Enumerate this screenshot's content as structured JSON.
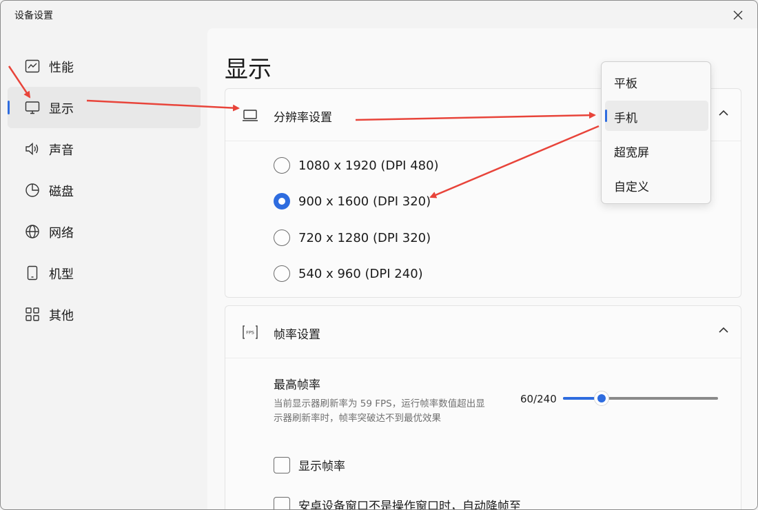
{
  "window": {
    "title": "设备设置"
  },
  "sidebar": {
    "items": [
      {
        "label": "性能",
        "icon": "performance-chart-icon",
        "active": false
      },
      {
        "label": "显示",
        "icon": "monitor-icon",
        "active": true
      },
      {
        "label": "声音",
        "icon": "speaker-icon",
        "active": false
      },
      {
        "label": "磁盘",
        "icon": "pie-chart-icon",
        "active": false
      },
      {
        "label": "网络",
        "icon": "globe-icon",
        "active": false
      },
      {
        "label": "机型",
        "icon": "phone-icon",
        "active": false
      },
      {
        "label": "其他",
        "icon": "grid-icon",
        "active": false
      }
    ]
  },
  "main": {
    "title": "显示",
    "resolution": {
      "title": "分辨率设置",
      "options": [
        {
          "label": "1080 x 1920 (DPI 480)",
          "checked": false
        },
        {
          "label": "900 x 1600 (DPI 320)",
          "checked": true
        },
        {
          "label": "720 x 1280 (DPI 320)",
          "checked": false
        },
        {
          "label": "540 x 960 (DPI 240)",
          "checked": false
        }
      ]
    },
    "framerate": {
      "title": "帧率设置",
      "icon_text": "FPS",
      "max_label": "最高帧率",
      "description": "当前显示器刷新率为 59 FPS，运行帧率数值超出显示器刷新率时，帧率突破达不到最优效果",
      "value_text": "60/240",
      "value": 60,
      "max": 240,
      "checkboxes": [
        {
          "label": "显示帧率",
          "checked": false
        },
        {
          "label": "安卓设备窗口不是操作窗口时，自动降帧至",
          "checked": false
        }
      ]
    }
  },
  "dropdown": {
    "items": [
      {
        "label": "平板",
        "selected": false
      },
      {
        "label": "手机",
        "selected": true
      },
      {
        "label": "超宽屏",
        "selected": false
      },
      {
        "label": "自定义",
        "selected": false
      }
    ]
  },
  "colors": {
    "accent": "#2e6cdf",
    "annotation": "#e8443a"
  }
}
